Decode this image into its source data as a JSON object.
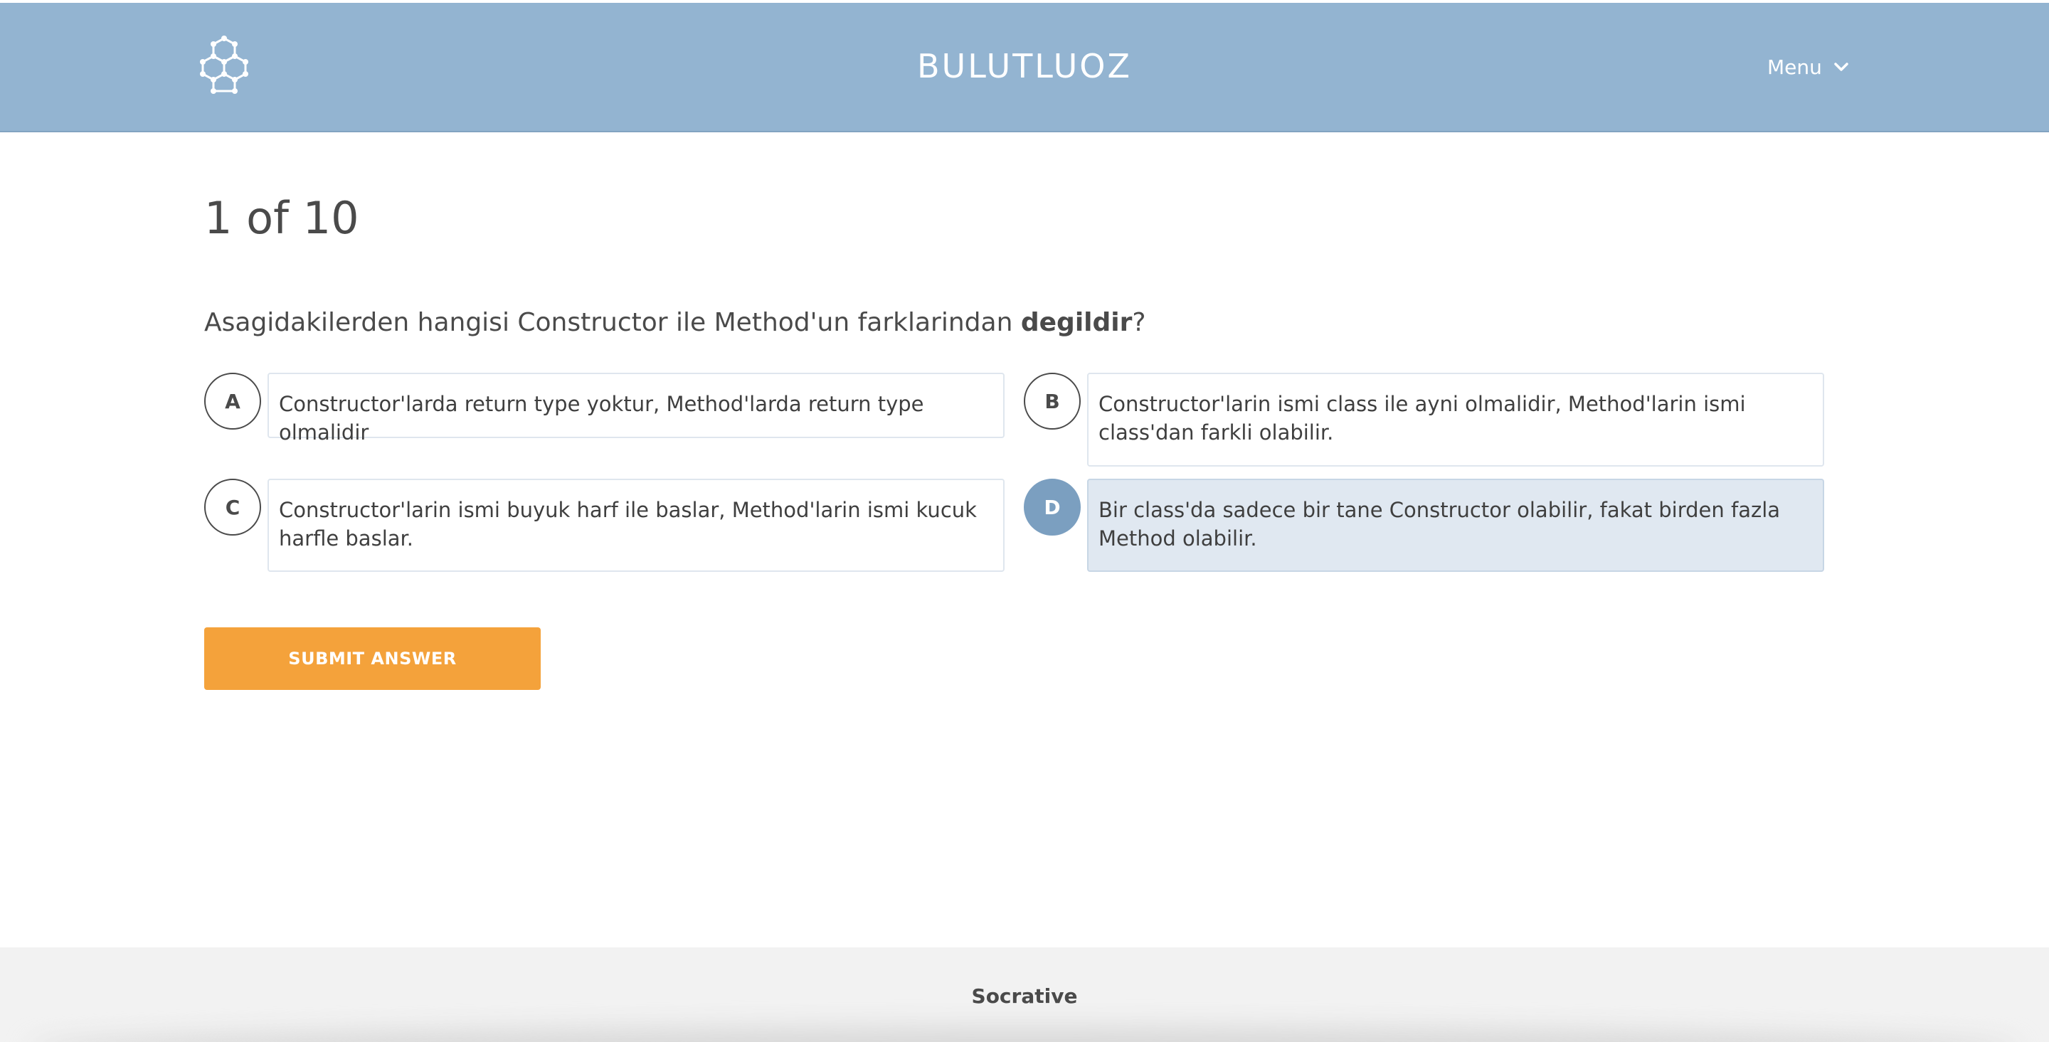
{
  "header": {
    "room_name": "BULUTLUOZ",
    "menu_label": "Menu",
    "background_color": "#93b4d1",
    "logo_icon": "hexagon-molecule-logo-icon",
    "menu_icon": "chevron-down-icon"
  },
  "quiz": {
    "progress": "1 of 10",
    "question_prefix": "Asagidakilerden hangisi Constructor ile Method'un farklarindan ",
    "question_bold": "degildir",
    "question_suffix": "?",
    "options": [
      {
        "letter": "A",
        "text": "Constructor'larda return type yoktur, Method'larda return type olmalidir",
        "selected": false
      },
      {
        "letter": "B",
        "text": "Constructor'larin ismi class ile ayni olmalidir, Method'larin ismi class'dan farkli olabilir.",
        "selected": false
      },
      {
        "letter": "C",
        "text": "Constructor'larin ismi buyuk harf ile baslar, Method'larin ismi kucuk harfle baslar.",
        "selected": false
      },
      {
        "letter": "D",
        "text": "Bir class'da sadece bir tane Constructor olabilir, fakat birden fazla Method olabilir.",
        "selected": true
      }
    ],
    "selected_color": "#7b9fc0",
    "submit_label": "SUBMIT ANSWER",
    "submit_color": "#f4a23b"
  },
  "footer": {
    "brand": "Socrative"
  }
}
